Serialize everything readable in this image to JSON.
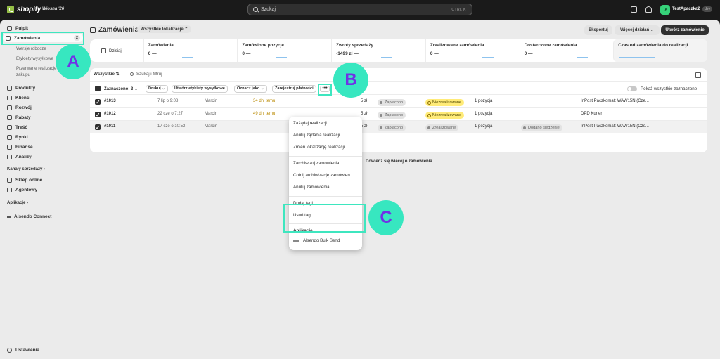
{
  "topbar": {
    "logo": "shopify",
    "edition": "Wiosna '26",
    "search_placeholder": "Szukaj",
    "search_shortcut": "CTRL  K",
    "avatar_initials": "TA",
    "store_name": "TestApaczka2",
    "store_badge": "dev"
  },
  "sidebar": {
    "items": [
      {
        "label": "Pulpit"
      },
      {
        "label": "Zamówienia",
        "count": "2"
      },
      {
        "label": "Produkty"
      },
      {
        "label": "Klienci"
      },
      {
        "label": "Rozwój"
      },
      {
        "label": "Rabaty"
      },
      {
        "label": "Treść"
      },
      {
        "label": "Rynki"
      },
      {
        "label": "Finanse"
      },
      {
        "label": "Analizy"
      }
    ],
    "subitems": [
      "Wersje robocze",
      "Etykiety wysyłkowe",
      "Przerwane realizacje",
      "zakupu"
    ],
    "sales_channels_label": "Kanały sprzedaży",
    "channels": [
      {
        "label": "Sklep online"
      },
      {
        "label": "Agentowy"
      }
    ],
    "apps_label": "Aplikacje",
    "apps": [
      {
        "label": "Alsendo Connect"
      }
    ],
    "settings_label": "Ustawienia"
  },
  "page": {
    "title": "Zamówienia",
    "location_filter": "Wszystkie lokalizacje",
    "export_btn": "Eksportuj",
    "more_actions_btn": "Więcej działań",
    "create_btn": "Utwórz zamówienie"
  },
  "metrics": {
    "today_label": "Dzisiaj",
    "cards": [
      {
        "label": "Zamówienia",
        "value": "0 —"
      },
      {
        "label": "Zamówione pozycje",
        "value": "0 —"
      },
      {
        "label": "Zwroty sprzedaży",
        "value": "-1499 zł —"
      },
      {
        "label": "Zrealizowane zamówienia",
        "value": "0 —"
      },
      {
        "label": "Dostarczone zamówienia",
        "value": "0 —"
      },
      {
        "label": "Czas od zamówienia do realizacji",
        "value": ""
      }
    ]
  },
  "filters": {
    "tab_all": "Wszystkie",
    "search_placeholder": "Szukaj i filtruj"
  },
  "bulk": {
    "selected": "Zaznaczono: 3",
    "print": "Drukuj",
    "labels": "Utwórz etykiety wysyłkowe",
    "mark_as": "Oznacz jako",
    "register_payments": "Zarejestruj płatności",
    "more": "•••",
    "show_all_selected": "Pokaż wszystkie zaznaczone"
  },
  "orders": [
    {
      "id": "#1013",
      "date": "7 lip o 9:08",
      "customer": "Marcin",
      "age": "34 dni temu",
      "amount": "5 zł",
      "payment": "Zapłacono",
      "fulfillment": "Niezrealizowane",
      "items": "1 pozycja",
      "tag": "",
      "shipping": "InPost Paczkomat: WAW15N (Cze..."
    },
    {
      "id": "#1012",
      "date": "22 cze o 7:27",
      "customer": "Marcin",
      "age": "49 dni temu",
      "amount": "5 zł",
      "payment": "Zapłacono",
      "fulfillment": "Niezrealizowane",
      "items": "1 pozycja",
      "tag": "",
      "shipping": "DPD Kurier"
    },
    {
      "id": "#1011",
      "date": "17 cze o 10:52",
      "customer": "Marcin",
      "age": "",
      "amount": "5 zł",
      "payment": "Zapłacono",
      "fulfillment": "Zrealizowane",
      "items": "1 pozycja",
      "tag": "Dodano śledzenie",
      "shipping": "InPost Paczkomat: WAW15N (Cze..."
    }
  ],
  "learn_more": "Dowiedz się więcej o zamówienia",
  "menu": {
    "group1": [
      "Zażądaj realizacji",
      "Anuluj żądania realizacji",
      "Zmień lokalizację realizacji"
    ],
    "group2": [
      "Zarchiwizuj zamówienia",
      "Cofnij archiwizację zamówień",
      "Anuluj zamówienia"
    ],
    "group3": [
      "Dodaj tagi",
      "Usuń tagi"
    ],
    "apps_title": "Aplikacje",
    "app_item": "Alsendo Bulk Send"
  },
  "callouts": {
    "a": "A",
    "b": "B",
    "c": "C"
  },
  "colors": {
    "accent": "#3ee6bf",
    "callout_text": "#7032e6",
    "primary_button": "#303030"
  }
}
